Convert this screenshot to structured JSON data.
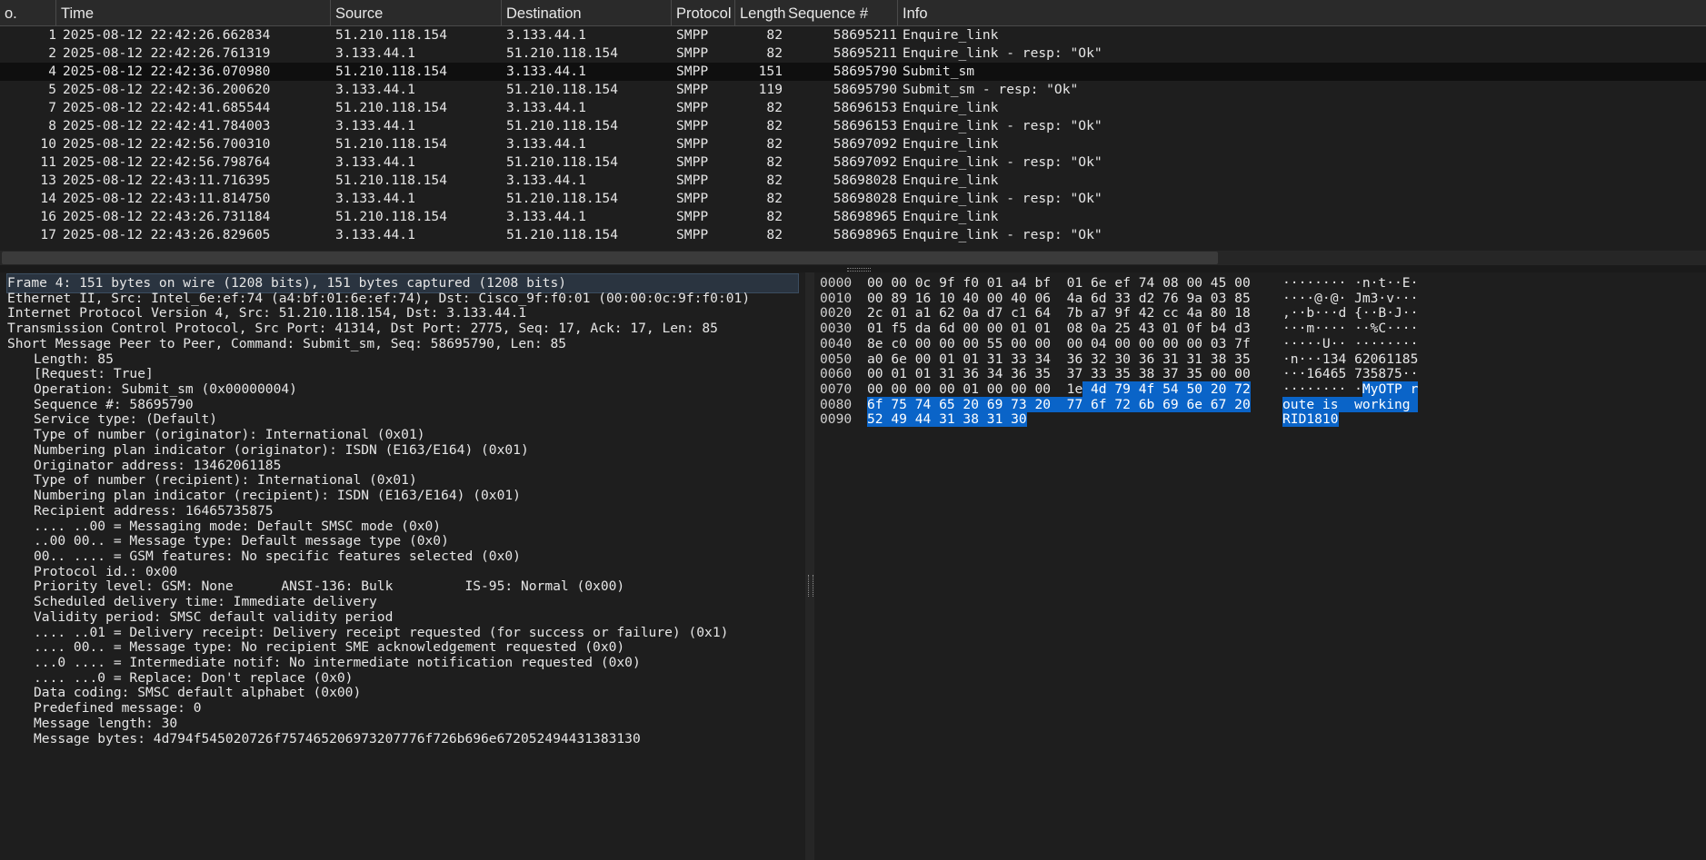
{
  "packet_list": {
    "columns": [
      "o.",
      "Time",
      "Source",
      "Destination",
      "Protocol",
      "Length",
      "Sequence #",
      "Info"
    ],
    "rows": [
      {
        "no": "1",
        "time": "2025-08-12 22:42:26.662834",
        "src": "51.210.118.154",
        "dst": "3.133.44.1",
        "proto": "SMPP",
        "len": "82",
        "seq": "58695211",
        "info": "Enquire_link"
      },
      {
        "no": "2",
        "time": "2025-08-12 22:42:26.761319",
        "src": "3.133.44.1",
        "dst": "51.210.118.154",
        "proto": "SMPP",
        "len": "82",
        "seq": "58695211",
        "info": "Enquire_link - resp: \"Ok\""
      },
      {
        "no": "4",
        "time": "2025-08-12 22:42:36.070980",
        "src": "51.210.118.154",
        "dst": "3.133.44.1",
        "proto": "SMPP",
        "len": "151",
        "seq": "58695790",
        "info": "Submit_sm",
        "selected": true
      },
      {
        "no": "5",
        "time": "2025-08-12 22:42:36.200620",
        "src": "3.133.44.1",
        "dst": "51.210.118.154",
        "proto": "SMPP",
        "len": "119",
        "seq": "58695790",
        "info": "Submit_sm - resp: \"Ok\""
      },
      {
        "no": "7",
        "time": "2025-08-12 22:42:41.685544",
        "src": "51.210.118.154",
        "dst": "3.133.44.1",
        "proto": "SMPP",
        "len": "82",
        "seq": "58696153",
        "info": "Enquire_link"
      },
      {
        "no": "8",
        "time": "2025-08-12 22:42:41.784003",
        "src": "3.133.44.1",
        "dst": "51.210.118.154",
        "proto": "SMPP",
        "len": "82",
        "seq": "58696153",
        "info": "Enquire_link - resp: \"Ok\""
      },
      {
        "no": "10",
        "time": "2025-08-12 22:42:56.700310",
        "src": "51.210.118.154",
        "dst": "3.133.44.1",
        "proto": "SMPP",
        "len": "82",
        "seq": "58697092",
        "info": "Enquire_link"
      },
      {
        "no": "11",
        "time": "2025-08-12 22:42:56.798764",
        "src": "3.133.44.1",
        "dst": "51.210.118.154",
        "proto": "SMPP",
        "len": "82",
        "seq": "58697092",
        "info": "Enquire_link - resp: \"Ok\""
      },
      {
        "no": "13",
        "time": "2025-08-12 22:43:11.716395",
        "src": "51.210.118.154",
        "dst": "3.133.44.1",
        "proto": "SMPP",
        "len": "82",
        "seq": "58698028",
        "info": "Enquire_link"
      },
      {
        "no": "14",
        "time": "2025-08-12 22:43:11.814750",
        "src": "3.133.44.1",
        "dst": "51.210.118.154",
        "proto": "SMPP",
        "len": "82",
        "seq": "58698028",
        "info": "Enquire_link - resp: \"Ok\""
      },
      {
        "no": "16",
        "time": "2025-08-12 22:43:26.731184",
        "src": "51.210.118.154",
        "dst": "3.133.44.1",
        "proto": "SMPP",
        "len": "82",
        "seq": "58698965",
        "info": "Enquire_link"
      },
      {
        "no": "17",
        "time": "2025-08-12 22:43:26.829605",
        "src": "3.133.44.1",
        "dst": "51.210.118.154",
        "proto": "SMPP",
        "len": "82",
        "seq": "58698965",
        "info": "Enquire_link - resp: \"Ok\""
      }
    ]
  },
  "details": {
    "lines": [
      {
        "text": "Frame 4: 151 bytes on wire (1208 bits), 151 bytes captured (1208 bits)",
        "level": 0,
        "highlight": true
      },
      {
        "text": "Ethernet II, Src: Intel_6e:ef:74 (a4:bf:01:6e:ef:74), Dst: Cisco_9f:f0:01 (00:00:0c:9f:f0:01)",
        "level": 0
      },
      {
        "text": "Internet Protocol Version 4, Src: 51.210.118.154, Dst: 3.133.44.1",
        "level": 0
      },
      {
        "text": "Transmission Control Protocol, Src Port: 41314, Dst Port: 2775, Seq: 17, Ack: 17, Len: 85",
        "level": 0
      },
      {
        "text": "Short Message Peer to Peer, Command: Submit_sm, Seq: 58695790, Len: 85",
        "level": 0
      },
      {
        "text": "Length: 85",
        "level": 1
      },
      {
        "text": "[Request: True]",
        "level": 1
      },
      {
        "text": "Operation: Submit_sm (0x00000004)",
        "level": 1
      },
      {
        "text": "Sequence #: 58695790",
        "level": 1
      },
      {
        "text": "Service type: (Default)",
        "level": 1
      },
      {
        "text": "Type of number (originator): International (0x01)",
        "level": 1
      },
      {
        "text": "Numbering plan indicator (originator): ISDN (E163/E164) (0x01)",
        "level": 1
      },
      {
        "text": "Originator address: 13462061185",
        "level": 1
      },
      {
        "text": "Type of number (recipient): International (0x01)",
        "level": 1
      },
      {
        "text": "Numbering plan indicator (recipient): ISDN (E163/E164) (0x01)",
        "level": 1
      },
      {
        "text": "Recipient address: 16465735875",
        "level": 1
      },
      {
        "text": ".... ..00 = Messaging mode: Default SMSC mode (0x0)",
        "level": 1
      },
      {
        "text": "..00 00.. = Message type: Default message type (0x0)",
        "level": 1
      },
      {
        "text": "00.. .... = GSM features: No specific features selected (0x0)",
        "level": 1
      },
      {
        "text": "Protocol id.: 0x00",
        "level": 1
      },
      {
        "text": "Priority level: GSM: None      ANSI-136: Bulk         IS-95: Normal (0x00)",
        "level": 1
      },
      {
        "text": "Scheduled delivery time: Immediate delivery",
        "level": 1
      },
      {
        "text": "Validity period: SMSC default validity period",
        "level": 1
      },
      {
        "text": ".... ..01 = Delivery receipt: Delivery receipt requested (for success or failure) (0x1)",
        "level": 1
      },
      {
        "text": ".... 00.. = Message type: No recipient SME acknowledgement requested (0x0)",
        "level": 1
      },
      {
        "text": "...0 .... = Intermediate notif: No intermediate notification requested (0x0)",
        "level": 1
      },
      {
        "text": ".... ...0 = Replace: Don't replace (0x0)",
        "level": 1
      },
      {
        "text": "Data coding: SMSC default alphabet (0x00)",
        "level": 1
      },
      {
        "text": "Predefined message: 0",
        "level": 1
      },
      {
        "text": "Message length: 30",
        "level": 1
      },
      {
        "text": "Message bytes: 4d794f545020726f757465206973207776f726b696e672052494431383130",
        "level": 1
      }
    ]
  },
  "hex": {
    "rows": [
      {
        "offset": "0000",
        "bytes": "00 00 0c 9f f0 01 a4 bf  01 6e ef 74 08 00 45 00",
        "ascii": "········ ·n·t··E·"
      },
      {
        "offset": "0010",
        "bytes": "00 89 16 10 40 00 40 06  4a 6d 33 d2 76 9a 03 85",
        "ascii": "····@·@· Jm3·v···"
      },
      {
        "offset": "0020",
        "bytes": "2c 01 a1 62 0a d7 c1 64  7b a7 9f 42 cc 4a 80 18",
        "ascii": ",··b···d {··B·J··"
      },
      {
        "offset": "0030",
        "bytes": "01 f5 da 6d 00 00 01 01  08 0a 25 43 01 0f b4 d3",
        "ascii": "···m···· ··%C····"
      },
      {
        "offset": "0040",
        "bytes": "8e c0 00 00 00 55 00 00  00 04 00 00 00 00 03 7f",
        "ascii": "·····U·· ········"
      },
      {
        "offset": "0050",
        "bytes": "a0 6e 00 01 01 31 33 34  36 32 30 36 31 31 38 35",
        "ascii": "·n···134 62061185"
      },
      {
        "offset": "0060",
        "bytes": "00 01 01 31 36 34 36 35  37 33 35 38 37 35 00 00",
        "ascii": "···16465 735875··"
      },
      {
        "offset": "0070",
        "bytes": "00 00 00 00 01 00 00 00  1e 4d 79 4f 54 50 20 72",
        "ascii": "········ ·MyOTP r",
        "sel_bytes_from": 27,
        "sel_ascii_from": 10
      },
      {
        "offset": "0080",
        "bytes": "6f 75 74 65 20 69 73 20  77 6f 72 6b 69 6e 67 20",
        "ascii": "oute is  working ",
        "sel_bytes_from": 0,
        "sel_ascii_from": 0
      },
      {
        "offset": "0090",
        "bytes": "52 49 44 31 38 31 30",
        "ascii": "RID1810",
        "sel_bytes_from": 0,
        "sel_ascii_from": 0
      }
    ]
  },
  "colors": {
    "background": "#1e1e1e",
    "selection": "#0a64c8",
    "selected_row": "#0f0f0f",
    "header": "#2a2a2a"
  }
}
